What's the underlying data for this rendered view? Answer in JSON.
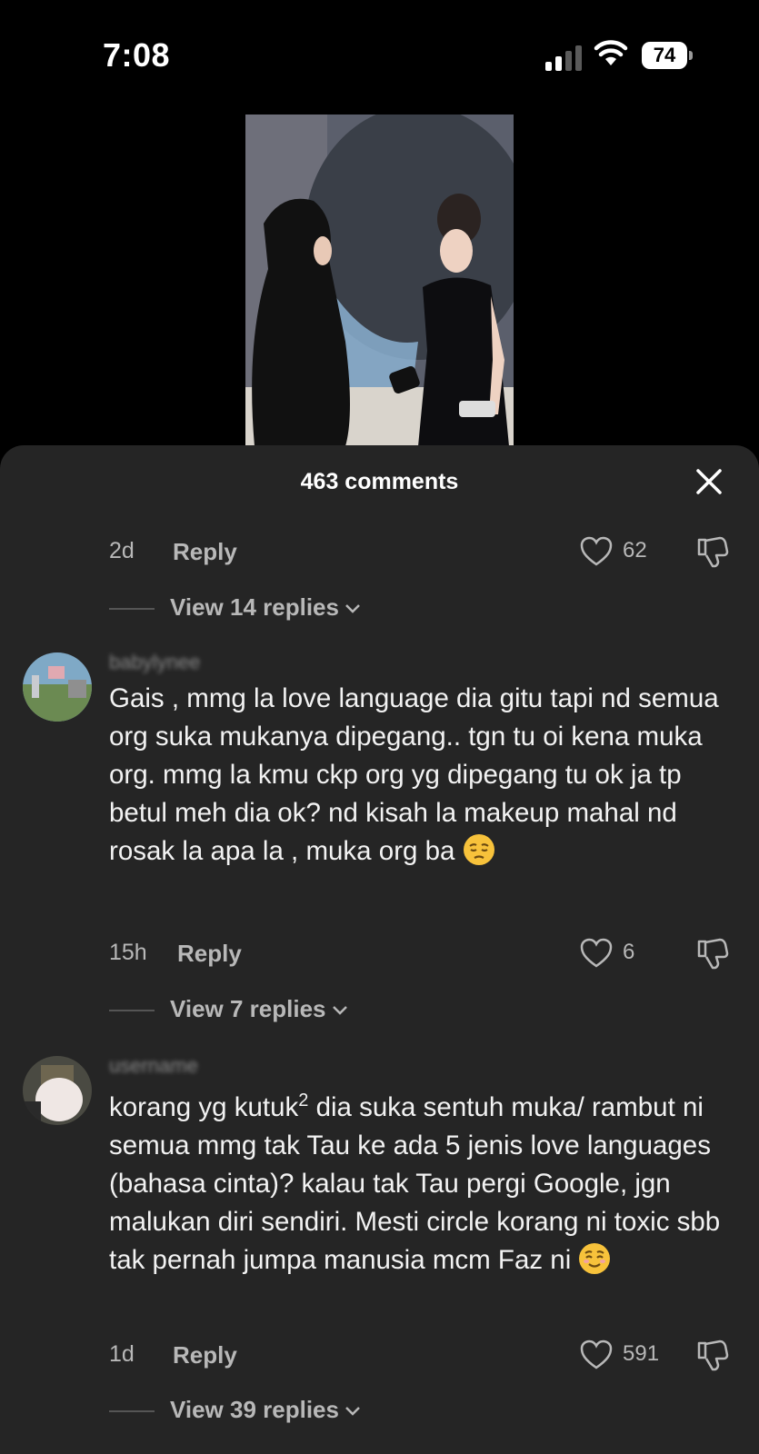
{
  "status_bar": {
    "time": "7:08",
    "battery_level": "74"
  },
  "sheet": {
    "title": "463 comments"
  },
  "top_comment": {
    "time": "2d",
    "reply_label": "Reply",
    "likes": "62",
    "view_replies": "View 14 replies"
  },
  "comments": [
    {
      "username": "babylynee",
      "text": "Gais , mmg la love language dia gitu tapi nd semua org suka mukanya dipegang.. tgn tu oi kena muka org. mmg la kmu ckp org yg dipegang tu ok ja tp betul meh dia ok? nd kisah la makeup mahal nd rosak la apa la , muka org ba",
      "emoji": "pensive-face",
      "time": "15h",
      "reply_label": "Reply",
      "likes": "6",
      "view_replies": "View 7 replies"
    },
    {
      "username": "username",
      "text_before_sup": "korang yg kutuk",
      "superscript": "2",
      "text_after_sup": " dia suka sentuh muka/ rambut ni semua mmg tak Tau ke ada 5 jenis love languages (bahasa cinta)? kalau tak Tau pergi Google, jgn malukan diri sendiri. Mesti circle korang ni toxic sbb tak pernah jumpa manusia mcm Faz ni",
      "emoji": "relieved-face",
      "time": "1d",
      "reply_label": "Reply",
      "likes": "591",
      "view_replies": "View 39 replies"
    }
  ],
  "colors": {
    "background": "#000000",
    "sheet": "#252525",
    "muted_text": "#b8b8b8",
    "emoji": "#f7c23b"
  }
}
